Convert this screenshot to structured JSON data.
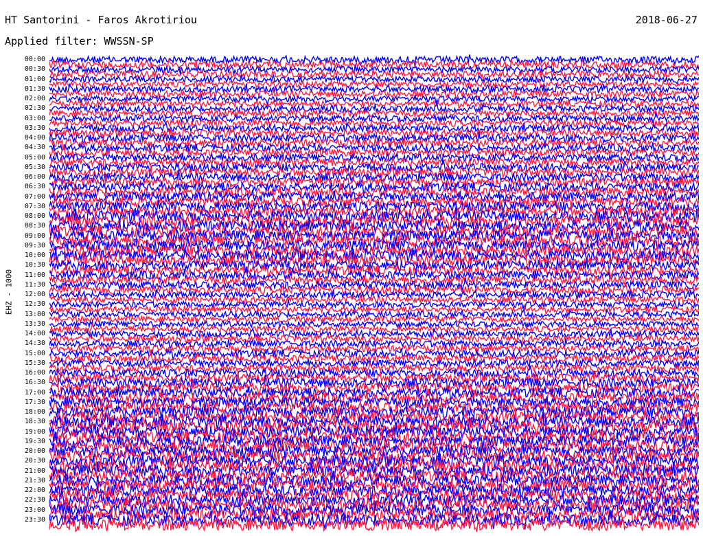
{
  "header": {
    "station": "HT Santorini - Faros Akrotiriou",
    "filter": "Applied filter: WWSSN-SP",
    "date": "2018-06-27"
  },
  "channel": "EHZ - 1000",
  "colors": {
    "trace_a": "#0000ff",
    "trace_b": "#ff1a40",
    "background": "#ffffff"
  },
  "chart_data": {
    "type": "line",
    "chart_kind": "helicorder seismogram",
    "row_labels": [
      "00:00",
      "00:30",
      "01:00",
      "01:30",
      "02:00",
      "02:30",
      "03:00",
      "03:30",
      "04:00",
      "04:30",
      "05:00",
      "05:30",
      "06:00",
      "06:30",
      "07:00",
      "07:30",
      "08:00",
      "08:30",
      "09:00",
      "09:30",
      "10:00",
      "10:30",
      "11:00",
      "11:30",
      "12:00",
      "12:30",
      "13:00",
      "13:30",
      "14:00",
      "14:30",
      "15:00",
      "15:30",
      "16:00",
      "16:30",
      "17:00",
      "17:30",
      "18:00",
      "18:30",
      "19:00",
      "19:30",
      "20:00",
      "20:30",
      "21:00",
      "21:30",
      "22:00",
      "22:30",
      "23:00",
      "23:30"
    ],
    "lines_per_label": 2,
    "line_duration_minutes": 15,
    "trace_colors_cycle": [
      "blue",
      "red"
    ],
    "relative_amplitude_by_label": [
      0.6,
      0.55,
      0.5,
      0.55,
      0.5,
      0.55,
      0.55,
      0.6,
      0.65,
      0.6,
      0.65,
      0.7,
      0.7,
      0.75,
      0.8,
      0.85,
      0.95,
      0.95,
      0.95,
      0.95,
      0.9,
      0.8,
      0.7,
      0.65,
      0.55,
      0.5,
      0.5,
      0.5,
      0.55,
      0.55,
      0.6,
      0.6,
      0.7,
      0.8,
      0.85,
      0.9,
      1.0,
      1.0,
      1.0,
      1.0,
      1.0,
      1.0,
      1.0,
      1.0,
      1.0,
      1.0,
      1.0,
      1.0
    ],
    "grid": false,
    "legend": "none"
  }
}
